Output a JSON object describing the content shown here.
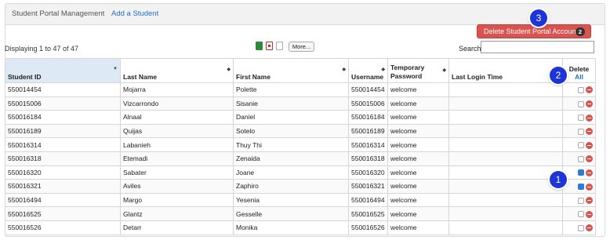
{
  "tabs": {
    "title": "Student Portal Management",
    "add_link": "Add a Student"
  },
  "delete_account_button": {
    "label": "Delete Student Portal Account",
    "count": "2"
  },
  "listing": {
    "displaying": "Displaying 1 to 47 of 47",
    "more_label": "More...",
    "search_label": "Search",
    "search_value": ""
  },
  "export_icons": [
    "excel-icon",
    "pdf-icon",
    "text-file-icon"
  ],
  "table": {
    "columns": {
      "student_id": "Student ID",
      "last_name": "Last Name",
      "first_name": "First Name",
      "username": "Username",
      "temp_password": "Temporary Password",
      "last_login": "Last Login Time",
      "delete": "Delete",
      "all": "All"
    },
    "rows": [
      {
        "student_id": "550014454",
        "last_name": "Mojarra",
        "first_name": "Polette",
        "username": "550014454",
        "temp_password": "welcome",
        "last_login": "",
        "checked": false
      },
      {
        "student_id": "550015006",
        "last_name": "Vizcarrondo",
        "first_name": "Sisanie",
        "username": "550015006",
        "temp_password": "welcome",
        "last_login": "",
        "checked": false
      },
      {
        "student_id": "550016184",
        "last_name": "Alnaal",
        "first_name": "Daniel",
        "username": "550016184",
        "temp_password": "welcome",
        "last_login": "",
        "checked": false
      },
      {
        "student_id": "550016189",
        "last_name": "Quijas",
        "first_name": "Sotelo",
        "username": "550016189",
        "temp_password": "welcome",
        "last_login": "",
        "checked": false
      },
      {
        "student_id": "550016314",
        "last_name": "Labanieh",
        "first_name": "Thuy Thi",
        "username": "550016314",
        "temp_password": "welcome",
        "last_login": "",
        "checked": false
      },
      {
        "student_id": "550016318",
        "last_name": "Etemadi",
        "first_name": "Zenaida",
        "username": "550016318",
        "temp_password": "welcome",
        "last_login": "",
        "checked": false
      },
      {
        "student_id": "550016320",
        "last_name": "Sabater",
        "first_name": "Joane",
        "username": "550016320",
        "temp_password": "welcome",
        "last_login": "",
        "checked": true
      },
      {
        "student_id": "550016321",
        "last_name": "Aviles",
        "first_name": "Zaphiro",
        "username": "550016321",
        "temp_password": "welcome",
        "last_login": "",
        "checked": true
      },
      {
        "student_id": "550016494",
        "last_name": "Margo",
        "first_name": "Yesenia",
        "username": "550016494",
        "temp_password": "welcome",
        "last_login": "",
        "checked": false
      },
      {
        "student_id": "550016525",
        "last_name": "Glantz",
        "first_name": "Gesselle",
        "username": "550016525",
        "temp_password": "welcome",
        "last_login": "",
        "checked": false
      },
      {
        "student_id": "550016526",
        "last_name": "Detarr",
        "first_name": "Monika",
        "username": "550016526",
        "temp_password": "welcome",
        "last_login": "",
        "checked": false
      }
    ]
  },
  "callouts": {
    "one": "1",
    "two": "2",
    "three": "3"
  },
  "colors": {
    "accent_blue": "#1d35d6",
    "link_blue": "#1f6fc9",
    "danger_red": "#d9534f",
    "sorted_header": "#dde9f5"
  }
}
